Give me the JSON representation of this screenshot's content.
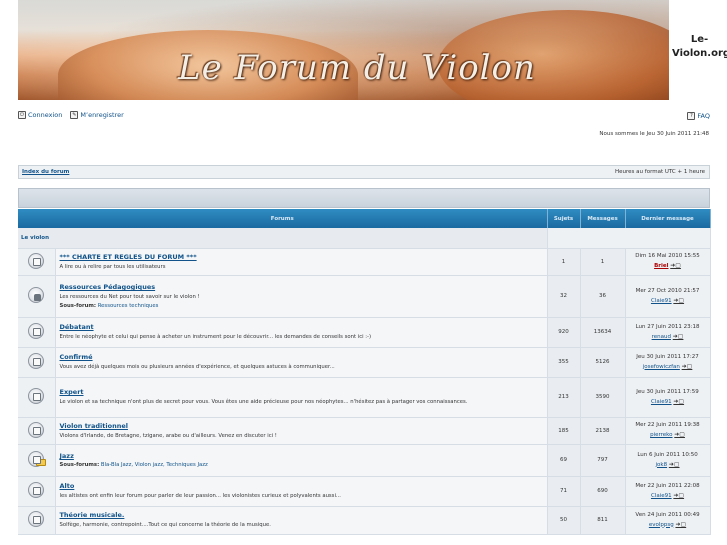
{
  "header": {
    "logo_text": "Le Forum du Violon",
    "site_name": "Le-Violon.org"
  },
  "nav": {
    "login_label": "Connexion",
    "login_icon": "login-icon",
    "register_label": "M’enregistrer",
    "register_icon": "register-icon",
    "faq_label": "FAQ",
    "faq_icon": "help-icon"
  },
  "datetime": "Nous sommes le Jeu 30 Juin 2011 21:48",
  "breadcrumb": {
    "home_label": "Index du forum",
    "timezone": "Heures au format UTC + 1 heure"
  },
  "table": {
    "headers": {
      "forums": "Forums",
      "topics": "Sujets",
      "posts": "Messages",
      "last_post": "Dernier message"
    },
    "category": "Le violon",
    "forums": [
      {
        "title": "*** CHARTE ET REGLES DU FORUM ***",
        "description": "A lire ou à relire par tous les utilisateurs",
        "subforums_label": "",
        "subforums": "",
        "topics": "1",
        "posts": "1",
        "last_date": "Dim 16 Mai 2010 15:55",
        "last_user": "Briel",
        "icon": "forum-read-icon"
      },
      {
        "title": "Ressources Pédagogiques",
        "description": "Les ressources du Net pour tout savoir sur le violon !",
        "subforums_label": "Sous-forum:",
        "subforums": "Ressources techniques",
        "topics": "32",
        "posts": "36",
        "last_date": "Mer 27 Oct 2010 21:57",
        "last_user": "Claie91",
        "icon": "forum-locked-icon"
      },
      {
        "title": "Débatant",
        "description": "Entre le néophyte et celui qui pense à acheter un instrument pour le découvrir... les demandes de conseils sont ici :-)",
        "subforums_label": "",
        "subforums": "",
        "topics": "920",
        "posts": "13634",
        "last_date": "Lun 27 Juin 2011 23:18",
        "last_user": "renaud",
        "icon": "forum-read-icon"
      },
      {
        "title": "Confirmé",
        "description": "Vous avez déjà quelques mois ou plusieurs années d'expérience, et quelques astuces à communiquer...",
        "subforums_label": "",
        "subforums": "",
        "topics": "355",
        "posts": "5126",
        "last_date": "Jeu 30 Juin 2011 17:27",
        "last_user": "josefowiczfan",
        "icon": "forum-read-icon"
      },
      {
        "title": "Expert",
        "description": "Le violon et sa technique n'ont plus de secret pour vous. Vous êtes une aide précieuse pour nos néophytes... n'hésitez pas à partager vos connaissances.",
        "subforums_label": "",
        "subforums": "",
        "topics": "213",
        "posts": "3590",
        "last_date": "Jeu 30 Juin 2011 17:59",
        "last_user": "Claie91",
        "icon": "forum-read-icon"
      },
      {
        "title": "Violon traditionnel",
        "description": "Violons d'Irlande, de Bretagne, tzigane, arabe ou d'ailleurs. Venez en discuter ici !",
        "subforums_label": "",
        "subforums": "",
        "topics": "185",
        "posts": "2138",
        "last_date": "Mer 22 Juin 2011 19:38",
        "last_user": "pierreko",
        "icon": "forum-read-icon"
      },
      {
        "title": "Jazz",
        "description": "",
        "subforums_label": "Sous-forums:",
        "subforums": "Bla-Bla Jazz, Violon jazz, Techniques Jazz",
        "topics": "69",
        "posts": "797",
        "last_date": "Lun 6 Juin 2011 10:50",
        "last_user": "jok8",
        "icon": "forum-subforum-icon"
      },
      {
        "title": "Alto",
        "description": "les altistes ont enfin leur forum pour parler de leur passion... les violonistes curieux et polyvalents aussi...",
        "subforums_label": "",
        "subforums": "",
        "topics": "71",
        "posts": "690",
        "last_date": "Mer 22 Juin 2011 22:08",
        "last_user": "Claie91",
        "icon": "forum-read-icon"
      },
      {
        "title": "Théorie musicale.",
        "description": "Solfège, harmonie, contrepoint....Tout ce qui concerne la théorie de la musique.",
        "subforums_label": "",
        "subforums": "",
        "topics": "50",
        "posts": "811",
        "last_date": "Ven 24 Juin 2011 00:49",
        "last_user": "evolppsg",
        "icon": "forum-read-icon"
      }
    ]
  }
}
